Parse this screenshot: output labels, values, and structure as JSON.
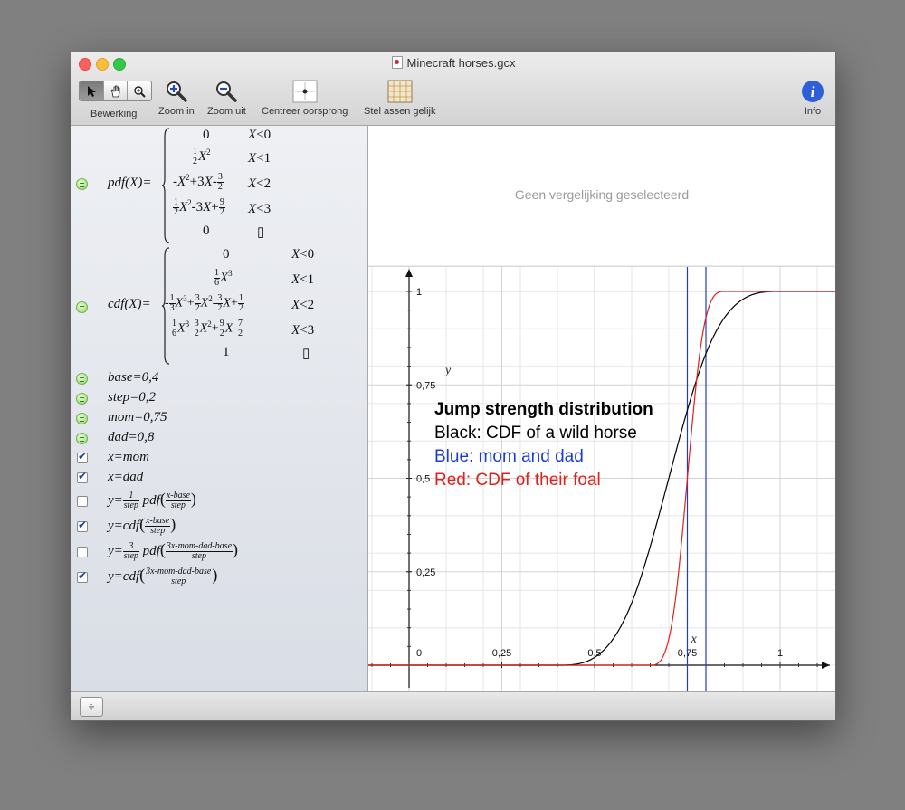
{
  "window": {
    "title": "Minecraft horses.gcx"
  },
  "toolbar": {
    "edit_label": "Bewerking",
    "zoom_in_label": "Zoom in",
    "zoom_out_label": "Zoom uit",
    "center_label": "Centreer oorsprong",
    "equal_axes_label": "Stel assen gelijk",
    "info_label": "Info",
    "bottom_add": "÷"
  },
  "equation_panel": {
    "empty_text": "Geen vergelijking geselecteerd"
  },
  "formulas": {
    "pdf": {
      "lhs": "pdf(X)=",
      "rows": [
        {
          "expr": "0",
          "cond": "X<0"
        },
        {
          "expr": "½X²",
          "cond": "X<1"
        },
        {
          "expr": "-X²+3X-3/2",
          "cond": "X<2"
        },
        {
          "expr": "½X²-3X+9/2",
          "cond": "X<3"
        },
        {
          "expr": "0",
          "cond": "▯"
        }
      ]
    },
    "cdf": {
      "lhs": "cdf(X)=",
      "rows": [
        {
          "expr": "0",
          "cond": "X<0"
        },
        {
          "expr": "1/6 X³",
          "cond": "X<1"
        },
        {
          "expr": "-1/3X³+3/2X²-3/2X+1/2",
          "cond": "X<2"
        },
        {
          "expr": "1/6X³-3/2X²+9/2X-7/2",
          "cond": "X<3"
        },
        {
          "expr": "1",
          "cond": "▯"
        }
      ]
    },
    "base": "base=0,4",
    "step": "step=0,2",
    "mom": "mom=0,75",
    "dad": "dad=0,8",
    "x_mom": "x=mom",
    "x_dad": "x=dad",
    "y1": {
      "lhs": "y=",
      "frac_num": "1",
      "frac_den": "step",
      "fn": "pdf",
      "arg_num": "x-base",
      "arg_den": "step",
      "checked": false
    },
    "y2": {
      "lhs": "y=cdf",
      "arg_num": "x-base",
      "arg_den": "step",
      "checked": true
    },
    "y3": {
      "lhs": "y=",
      "frac_num": "3",
      "frac_den": "step",
      "fn": "pdf",
      "arg_num": "3x-mom-dad-base",
      "arg_den": "step",
      "checked": false
    },
    "y4": {
      "lhs": "y=cdf",
      "arg_num": "3x-mom-dad-base",
      "arg_den": "step",
      "checked": true
    }
  },
  "graph": {
    "x_axis_label": "x",
    "y_axis_label": "y",
    "x_ticks": [
      "0",
      "0,25",
      "0,5",
      "0,75",
      "1"
    ],
    "y_ticks": [
      "0,25",
      "0,5",
      "0,75",
      "1"
    ],
    "annotation": {
      "title": "Jump strength distribution",
      "line1": "Black: CDF of a wild horse",
      "line2": "Blue: mom and dad",
      "line3": "Red: CDF of their foal"
    },
    "colors": {
      "black": "#000000",
      "blue": "#1a3cd6",
      "red": "#e0201a"
    }
  },
  "chart_data": {
    "type": "line",
    "title": "Jump strength distribution",
    "xlabel": "x",
    "ylabel": "y",
    "xlim": [
      -0.1,
      1.15
    ],
    "ylim": [
      -0.02,
      1.05
    ],
    "grid": true,
    "params": {
      "base": 0.4,
      "step": 0.2,
      "mom": 0.75,
      "dad": 0.8
    },
    "series": [
      {
        "name": "Black: CDF of a wild horse",
        "formula": "cdf((x-base)/step)",
        "color": "#000000"
      },
      {
        "name": "Red: CDF of their foal",
        "formula": "cdf((3x-mom-dad-base)/step)",
        "color": "#e0201a"
      }
    ],
    "vlines": [
      {
        "name": "mom",
        "x": 0.75,
        "color": "#1a3cd6"
      },
      {
        "name": "dad",
        "x": 0.8,
        "color": "#1a3cd6"
      }
    ]
  }
}
